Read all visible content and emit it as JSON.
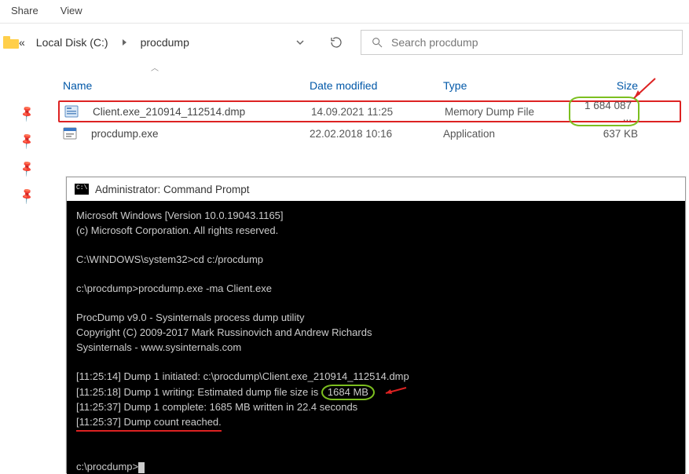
{
  "ribbon": {
    "share": "Share",
    "view": "View"
  },
  "breadcrumb": {
    "prefix": "«",
    "disk": "Local Disk (C:)",
    "folder": "procdump"
  },
  "search": {
    "placeholder": "Search procdump"
  },
  "columns": {
    "name": "Name",
    "date": "Date modified",
    "type": "Type",
    "size": "Size"
  },
  "files": [
    {
      "name": "Client.exe_210914_112514.dmp",
      "date": "14.09.2021 11:25",
      "type": "Memory Dump File",
      "size": "1 684 087 ..."
    },
    {
      "name": "procdump.exe",
      "date": "22.02.2018 10:16",
      "type": "Application",
      "size": "637 KB"
    }
  ],
  "cmd": {
    "title": "Administrator: Command Prompt",
    "l1": "Microsoft Windows [Version 10.0.19043.1165]",
    "l2": "(c) Microsoft Corporation. All rights reserved.",
    "l3": "C:\\WINDOWS\\system32>cd c:/procdump",
    "l4": "c:\\procdump>procdump.exe -ma Client.exe",
    "l5": "ProcDump v9.0 - Sysinternals process dump utility",
    "l6": "Copyright (C) 2009-2017 Mark Russinovich and Andrew Richards",
    "l7": "Sysinternals - www.sysinternals.com",
    "l8": "[11:25:14] Dump 1 initiated: c:\\procdump\\Client.exe_210914_112514.dmp",
    "l9a": "[11:25:18] Dump 1 writing: Estimated dump file size is ",
    "l9b": "1684 MB",
    "l10": "[11:25:37] Dump 1 complete: 1685 MB written in 22.4 seconds",
    "l11": "[11:25:37] Dump count reached.",
    "l12": "c:\\procdump>"
  }
}
